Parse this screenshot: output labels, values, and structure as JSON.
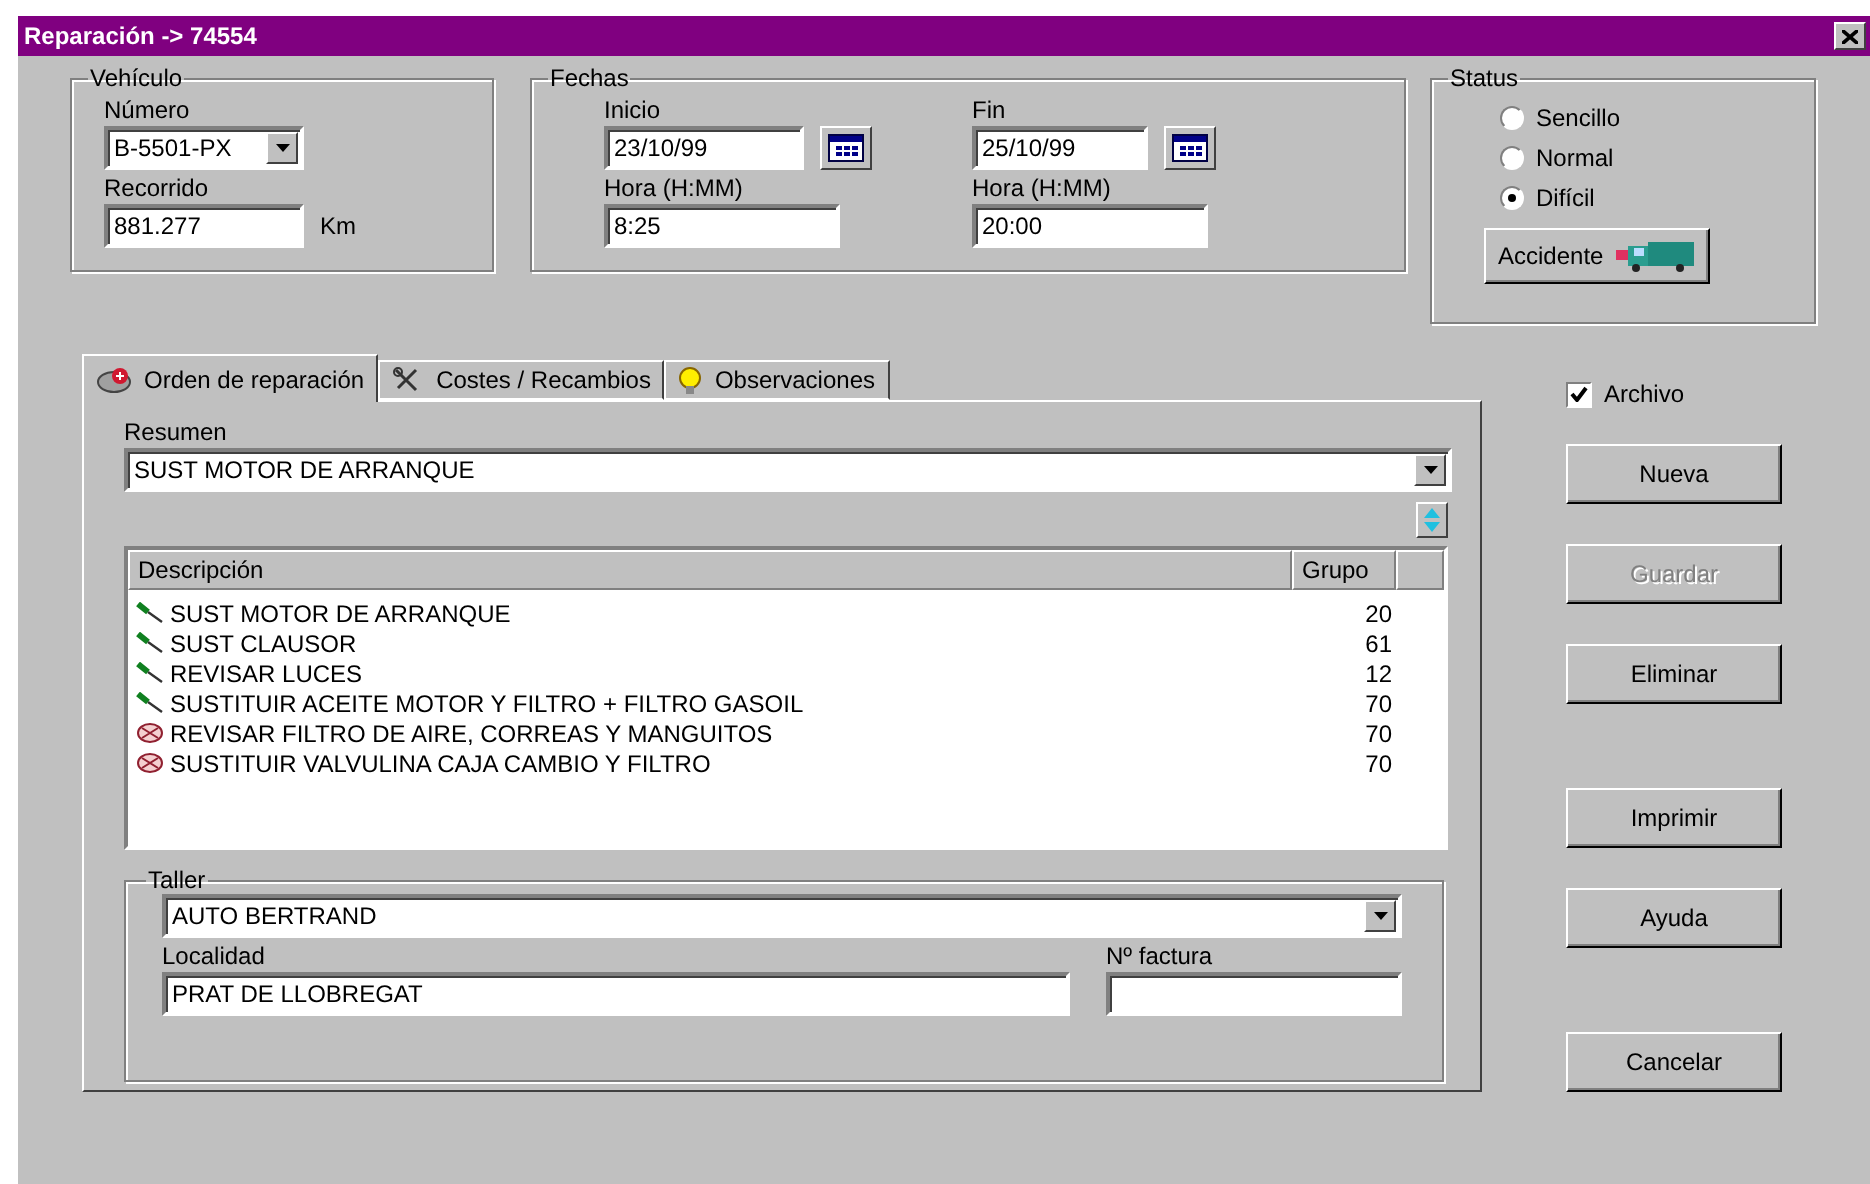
{
  "window": {
    "title": "Reparación -> 74554"
  },
  "vehiculo": {
    "title": "Vehículo",
    "numero_label": "Número",
    "numero": "B-5501-PX",
    "recorrido_label": "Recorrido",
    "recorrido": "881.277",
    "unit": "Km"
  },
  "fechas": {
    "title": "Fechas",
    "inicio_label": "Inicio",
    "inicio": "23/10/99",
    "fin_label": "Fin",
    "fin": "25/10/99",
    "hora_inicio_label": "Hora (H:MM)",
    "hora_inicio": "8:25",
    "hora_fin_label": "Hora (H:MM)",
    "hora_fin": "20:00"
  },
  "status": {
    "title": "Status",
    "options": [
      {
        "label": "Sencillo",
        "selected": false
      },
      {
        "label": "Normal",
        "selected": false
      },
      {
        "label": "Difícil",
        "selected": true
      }
    ],
    "accident_button": "Accidente"
  },
  "tabs": [
    {
      "label": "Orden de reparación",
      "kind": "order",
      "selected": true
    },
    {
      "label": "Costes / Recambios",
      "kind": "costs",
      "selected": false
    },
    {
      "label": "Observaciones",
      "kind": "notes",
      "selected": false
    }
  ],
  "resumen": {
    "label": "Resumen",
    "value": "SUST MOTOR DE ARRANQUE"
  },
  "table": {
    "columns": [
      "Descripción",
      "Grupo"
    ],
    "rows": [
      {
        "kind": "wrench",
        "descripcion": "SUST MOTOR DE ARRANQUE",
        "grupo": "20"
      },
      {
        "kind": "wrench",
        "descripcion": "SUST CLAUSOR",
        "grupo": "61"
      },
      {
        "kind": "wrench",
        "descripcion": "REVISAR LUCES",
        "grupo": "12"
      },
      {
        "kind": "wrench",
        "descripcion": "SUSTITUIR ACEITE MOTOR Y FILTRO + FILTRO GASOIL",
        "grupo": "70"
      },
      {
        "kind": "part",
        "descripcion": "REVISAR FILTRO DE AIRE, CORREAS Y MANGUITOS",
        "grupo": "70"
      },
      {
        "kind": "part",
        "descripcion": "SUSTITUIR VALVULINA CAJA CAMBIO Y FILTRO",
        "grupo": "70"
      }
    ]
  },
  "taller": {
    "title": "Taller",
    "value": "AUTO BERTRAND",
    "localidad_label": "Localidad",
    "localidad": "PRAT DE LLOBREGAT",
    "factura_label": "Nº factura"
  },
  "archivo": {
    "label": "Archivo",
    "checked": true
  },
  "button_groups": [
    [
      {
        "label": "Nueva",
        "disabled": false
      },
      {
        "label": "Guardar",
        "disabled": true
      },
      {
        "label": "Eliminar",
        "disabled": false
      }
    ],
    [
      {
        "label": "Imprimir",
        "disabled": false
      },
      {
        "label": "Ayuda",
        "disabled": false
      }
    ],
    [
      {
        "label": "Cancelar",
        "disabled": false
      }
    ]
  ]
}
